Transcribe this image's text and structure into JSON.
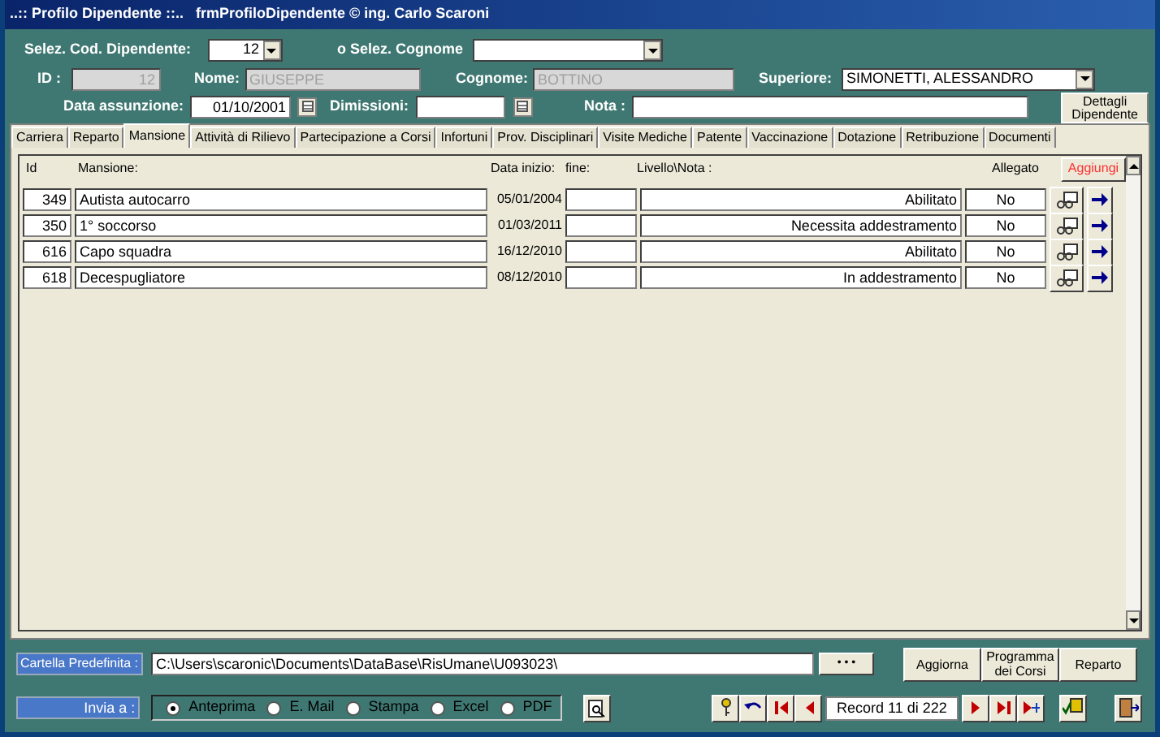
{
  "window": {
    "title": "..:: Profilo Dipendente ::..   frmProfiloDipendente © ing. Carlo Scaroni"
  },
  "header": {
    "cod_label": "Selez. Cod. Dipendente:",
    "cod_value": "12",
    "cognome_select_label": "o Selez. Cognome",
    "id_label": "ID :",
    "id_value": "12",
    "nome_label": "Nome:",
    "nome_value": "GIUSEPPE",
    "cognome_label": "Cognome:",
    "cognome_value": "BOTTINO",
    "superiore_label": "Superiore:",
    "superiore_value": "SIMONETTI, ALESSANDRO",
    "assunzione_label": "Data assunzione:",
    "assunzione_value": "01/10/2001",
    "dimissioni_label": "Dimissioni:",
    "nota_label": "Nota :",
    "dettagli_button": "Dettagli Dipendente"
  },
  "tabs": [
    {
      "label": "Carriera",
      "selected": false
    },
    {
      "label": "Reparto",
      "selected": false
    },
    {
      "label": "Mansione",
      "selected": true
    },
    {
      "label": "Attività di Rilievo",
      "selected": false
    },
    {
      "label": "Partecipazione a Corsi",
      "selected": false
    },
    {
      "label": "Infortuni",
      "selected": false
    },
    {
      "label": "Prov. Disciplinari",
      "selected": false
    },
    {
      "label": "Visite Mediche",
      "selected": false
    },
    {
      "label": "Patente",
      "selected": false
    },
    {
      "label": "Vaccinazione",
      "selected": false
    },
    {
      "label": "Dotazione",
      "selected": false
    },
    {
      "label": "Retribuzione",
      "selected": false
    },
    {
      "label": "Documenti",
      "selected": false
    }
  ],
  "table": {
    "columns": [
      "Id",
      "Mansione:",
      "Data inizio:",
      "fine:",
      "Livello\\Nota :",
      "Allegato"
    ],
    "add_button": "Aggiungi",
    "rows": [
      {
        "id": "349",
        "mansione": "Autista autocarro",
        "inizio": "05/01/2004",
        "livello": "Abilitato",
        "allegato": "No"
      },
      {
        "id": "350",
        "mansione": "1° soccorso",
        "inizio": "01/03/2011",
        "livello": "Necessita addestramento",
        "allegato": "No"
      },
      {
        "id": "616",
        "mansione": "Capo squadra",
        "inizio": "16/12/2010",
        "livello": "Abilitato",
        "allegato": "No"
      },
      {
        "id": "618",
        "mansione": "Decespugliatore",
        "inizio": "08/12/2010",
        "livello": "In addestramento",
        "allegato": "No"
      }
    ]
  },
  "footer": {
    "cartella_label": "Cartella Predefinita :",
    "cartella_value": "C:\\Users\\scaronic\\Documents\\DataBase\\RisUmane\\U093023\\",
    "browse_button": "• • •",
    "buttons": [
      "Aggiorna",
      "Programma dei Corsi",
      "Reparto"
    ],
    "invia_label": "Invia a :",
    "options": [
      {
        "label": "Anteprima",
        "selected": true
      },
      {
        "label": "E. Mail",
        "selected": false
      },
      {
        "label": "Stampa",
        "selected": false
      },
      {
        "label": "Excel",
        "selected": false
      },
      {
        "label": "PDF",
        "selected": false
      }
    ],
    "record": "Record 11 di 222"
  }
}
